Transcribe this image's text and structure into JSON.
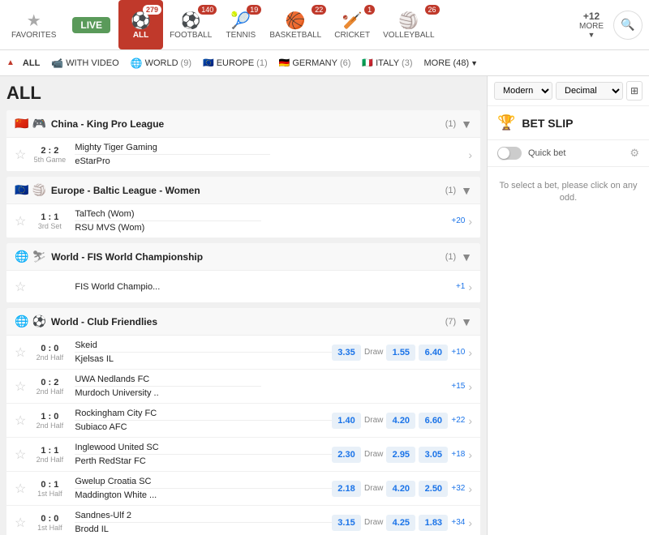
{
  "nav": {
    "favorites_label": "FAVORITES",
    "live_label": "LIVE",
    "all_label": "ALL",
    "all_count": "279",
    "football_label": "FOOTBALL",
    "football_count": "140",
    "tennis_label": "TENNIS",
    "tennis_count": "19",
    "basketball_label": "BASKETBALL",
    "basketball_count": "22",
    "cricket_label": "CRICKET",
    "cricket_count": "1",
    "volleyball_label": "VOLLEYBALL",
    "volleyball_count": "26",
    "more_label": "MORE",
    "more_count": "+12"
  },
  "sub_nav": {
    "all_label": "ALL",
    "with_video_label": "WITH VIDEO",
    "world_label": "WORLD",
    "world_count": "(9)",
    "europe_label": "EUROPE",
    "europe_count": "(1)",
    "germany_label": "GERMANY",
    "germany_count": "(6)",
    "italy_label": "ITALY",
    "italy_count": "(3)",
    "more_label": "MORE (48)"
  },
  "page_title": "ALL",
  "leagues": [
    {
      "id": "china",
      "flag": "🇨🇳",
      "sport_icon": "🎮",
      "name": "China - King Pro League",
      "count": "(1)",
      "matches": [
        {
          "score": "2 : 2",
          "label": "5th Game",
          "home": "Mighty Tiger Gaming",
          "away": "eStarPro",
          "has_odds": false,
          "extra": ""
        }
      ]
    },
    {
      "id": "europe",
      "flag": "🇪🇺",
      "sport_icon": "🏐",
      "name": "Europe - Baltic League - Women",
      "count": "(1)",
      "matches": [
        {
          "score": "1 : 1",
          "label": "3rd Set",
          "home": "TalTech (Wom)",
          "away": "RSU MVS (Wom)",
          "has_odds": false,
          "extra": "+20"
        }
      ]
    },
    {
      "id": "world-fis",
      "flag": "🌐",
      "sport_icon": "⛷",
      "name": "World - FIS World Championship",
      "count": "(1)",
      "matches": [
        {
          "score": "",
          "label": "",
          "home": "FIS World Champio...",
          "away": "",
          "has_odds": false,
          "extra": "+1",
          "single": true
        }
      ]
    },
    {
      "id": "world-club",
      "flag": "🌐",
      "sport_icon": "⚽",
      "name": "World - Club Friendlies",
      "count": "(7)",
      "matches": [
        {
          "score": "0 : 0",
          "label": "2nd Half",
          "home": "Skeid",
          "home_odd": "3.35",
          "draw_label": "Draw",
          "draw_odd": "1.55",
          "away": "Kjelsas IL",
          "away_odd": "6.40",
          "extra": "+10"
        },
        {
          "score": "0 : 2",
          "label": "2nd Half",
          "home": "UWA Nedlands FC",
          "home_odd": "",
          "draw_label": "",
          "draw_odd": "",
          "away": "Murdoch University ..",
          "away_odd": "",
          "extra": "+15"
        },
        {
          "score": "1 : 0",
          "label": "2nd Half",
          "home": "Rockingham City FC",
          "home_odd": "1.40",
          "draw_label": "Draw",
          "draw_odd": "4.20",
          "away": "Subiaco AFC",
          "away_odd": "6.60",
          "extra": "+22"
        },
        {
          "score": "1 : 1",
          "label": "2nd Half",
          "home": "Inglewood United SC",
          "home_odd": "2.30",
          "draw_label": "Draw",
          "draw_odd": "2.95",
          "away": "Perth RedStar FC",
          "away_odd": "3.05",
          "extra": "+18"
        },
        {
          "score": "0 : 1",
          "label": "1st Half",
          "home": "Gwelup Croatia SC",
          "home_odd": "2.18",
          "draw_label": "Draw",
          "draw_odd": "4.20",
          "away": "Maddington White ...",
          "away_odd": "2.50",
          "extra": "+32"
        },
        {
          "score": "0 : 0",
          "label": "1st Half",
          "home": "Sandnes-Ulf 2",
          "home_odd": "3.15",
          "draw_label": "Draw",
          "draw_odd": "4.25",
          "away": "Brodd IL",
          "away_odd": "1.83",
          "extra": "+34"
        }
      ]
    }
  ],
  "bet_slip": {
    "modern_label": "Modern",
    "decimal_label": "Decimal",
    "title": "BET SLIP",
    "quick_bet_label": "Quick bet",
    "message": "To select a bet, please click on any odd."
  }
}
